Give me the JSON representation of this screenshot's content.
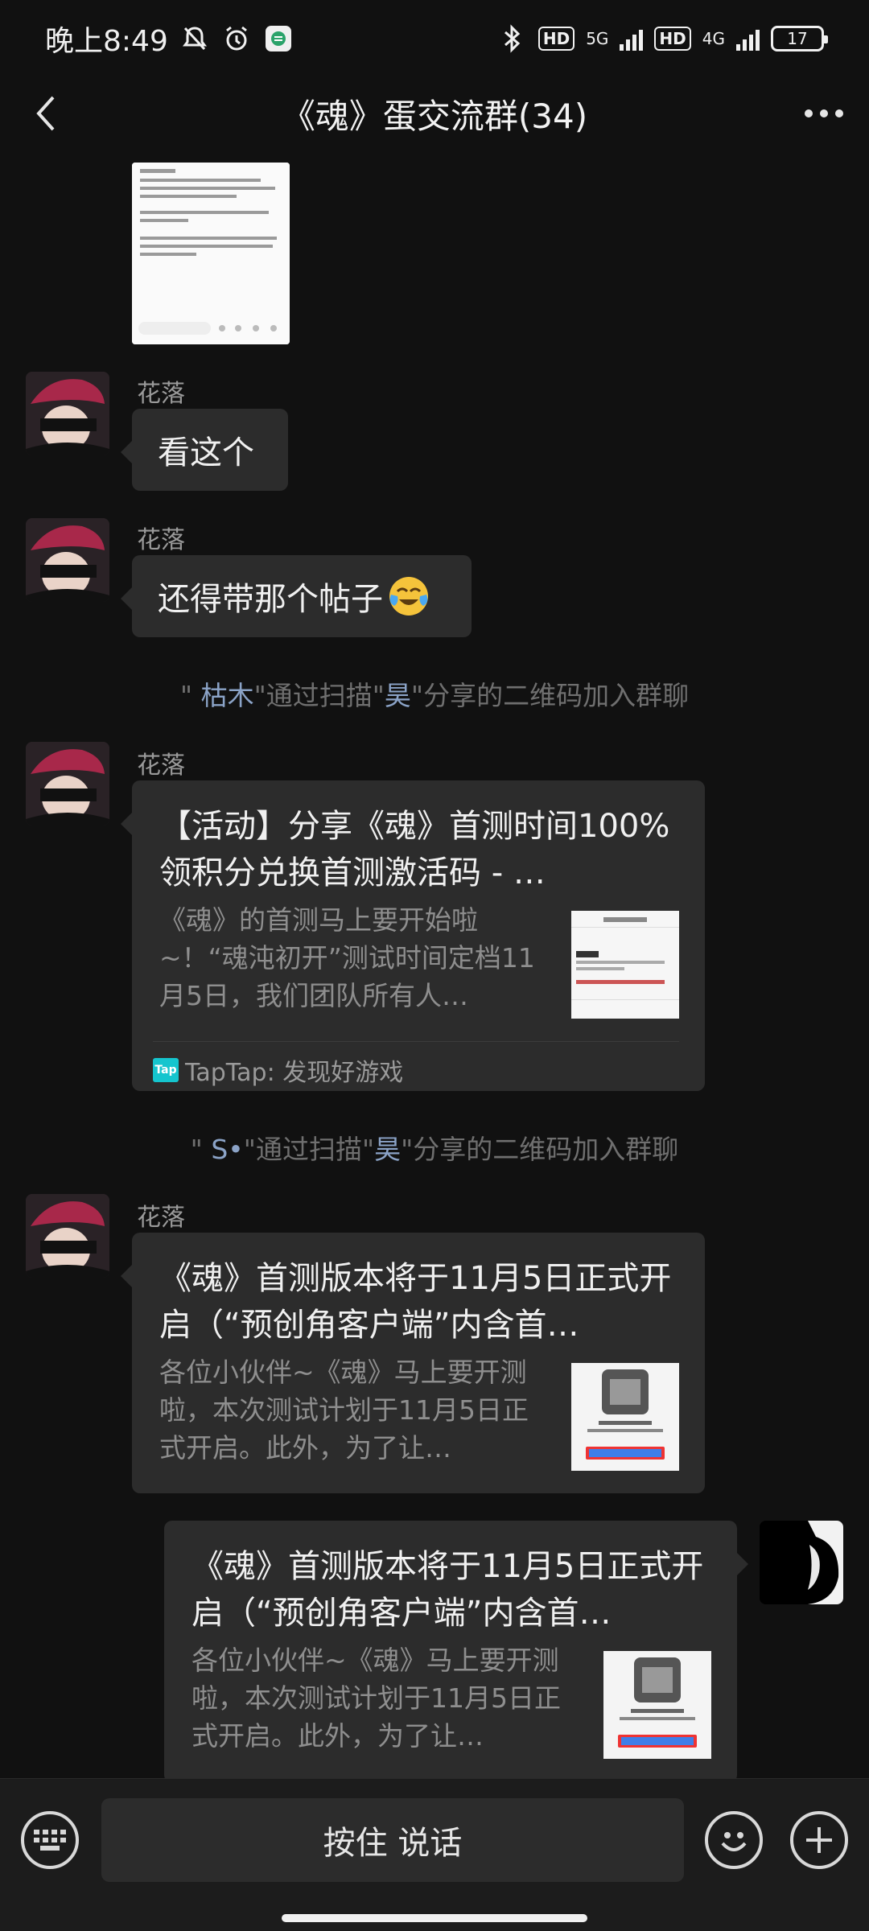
{
  "status_bar": {
    "time": "晚上8:49",
    "hd1": "HD",
    "net1": "5G",
    "hd2": "HD",
    "net2": "4G",
    "battery": "17"
  },
  "header": {
    "title": "《魂》蛋交流群(34)"
  },
  "messages": {
    "m1": {
      "sender": "花落",
      "text": "看这个"
    },
    "m2": {
      "sender": "花落",
      "text": "还得带那个帖子"
    },
    "sys1": {
      "prefix": "\" ",
      "name": "枯木",
      "mid": "\"通过扫描\"",
      "name2": "昊",
      "suffix": "\"分享的二维码加入群聊"
    },
    "m3": {
      "sender": "花落",
      "title": "【活动】分享《魂》首测时间100%领积分兑换首测激活码 - …",
      "desc": "《魂》的首测马上要开始啦~！“魂沌初开”测试时间定档11月5日，我们团队所有人…",
      "source": "TapTap: 发现好游戏",
      "source_logo": "Tap"
    },
    "sys2": {
      "prefix": "\" ",
      "name": "S•",
      "mid": "\"通过扫描\"",
      "name2": "昊",
      "suffix": "\"分享的二维码加入群聊"
    },
    "m4": {
      "sender": "花落",
      "title": "《魂》首测版本将于11月5日正式开启（“预创角客户端”内含首…",
      "desc": "各位小伙伴~《魂》马上要开测啦，本次测试计划于11月5日正式开启。此外，为了让…"
    },
    "m5": {
      "title": "《魂》首测版本将于11月5日正式开启（“预创角客户端”内含首…",
      "desc": "各位小伙伴~《魂》马上要开测啦，本次测试计划于11月5日正式开启。此外，为了让…"
    }
  },
  "input_bar": {
    "hold_to_talk": "按住 说话"
  },
  "icons": {
    "back": "chevron-left-icon",
    "more": "more-dots-icon",
    "keyboard": "keyboard-icon",
    "emoji": "emoji-icon",
    "plus": "plus-icon"
  },
  "colors": {
    "background": "#111111",
    "bubble": "#2c2c2c",
    "system_highlight": "#8ba3c7",
    "taptap": "#15c5ce"
  }
}
